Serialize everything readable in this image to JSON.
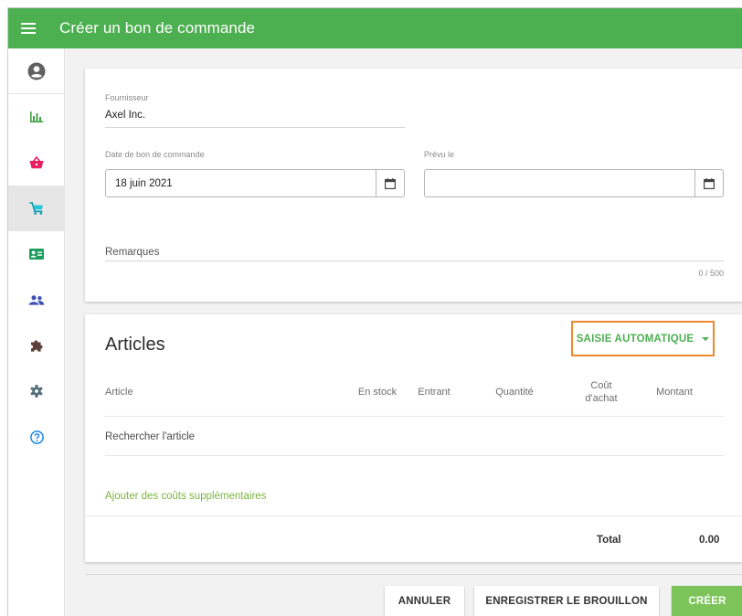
{
  "app": {
    "title": "Créer un bon de commande"
  },
  "colors": {
    "accent": "#4caf50",
    "highlight_border": "#ef8a2e",
    "link_green": "#7cb342",
    "create_button": "#7cc45a"
  },
  "sidebar": {
    "items": [
      {
        "icon": "account-circle-icon",
        "active": false
      },
      {
        "icon": "bar-chart-icon",
        "active": false
      },
      {
        "icon": "shopping-basket-icon",
        "active": false
      },
      {
        "icon": "purchase-cart-icon",
        "active": true
      },
      {
        "icon": "contact-card-icon",
        "active": false
      },
      {
        "icon": "people-icon",
        "active": false
      },
      {
        "icon": "puzzle-piece-icon",
        "active": false
      },
      {
        "icon": "settings-icon",
        "active": false
      },
      {
        "icon": "help-circle-icon",
        "active": false
      }
    ]
  },
  "form": {
    "supplier": {
      "label": "Fournisseur",
      "value": "Axel Inc."
    },
    "order_date": {
      "label": "Date de bon de commande",
      "value": "18 juin 2021"
    },
    "expected": {
      "label": "Prévu le",
      "value": ""
    },
    "remarks": {
      "placeholder": "Remarques",
      "counter": "0 / 500"
    }
  },
  "articles": {
    "title": "Articles",
    "auto_button": "SAISIE AUTOMATIQUE",
    "columns": {
      "article": "Article",
      "in_stock": "En stock",
      "incoming": "Entrant",
      "quantity": "Quantité",
      "cost_line1": "Coût",
      "cost_line2": "d'achat",
      "amount": "Montant"
    },
    "search_placeholder": "Rechercher l'article",
    "add_costs": "Ajouter des coûts supplémentaires",
    "total_label": "Total",
    "total_value": "0.00"
  },
  "footer": {
    "cancel": "ANNULER",
    "save_draft": "ENREGISTRER LE BROUILLON",
    "create": "CRÉER"
  }
}
